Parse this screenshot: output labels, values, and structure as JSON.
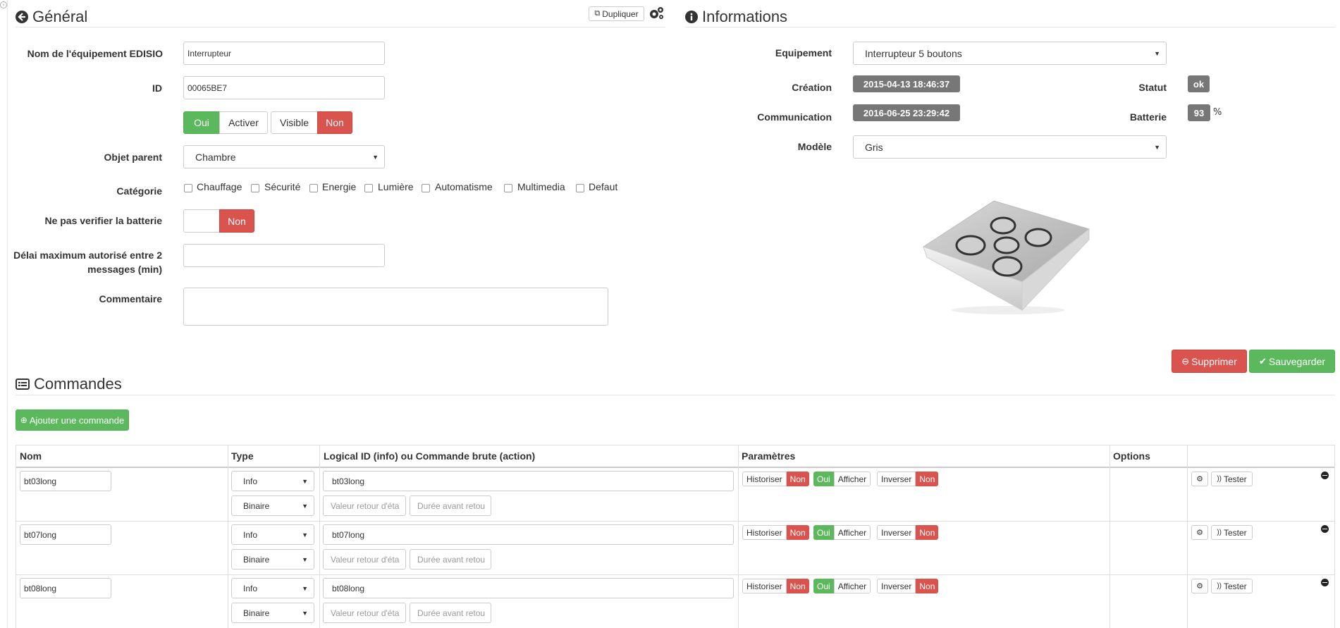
{
  "general": {
    "title": "Général",
    "duplicate_label": "Dupliquer",
    "fields": {
      "name_label": "Nom de l'équipement EDISIO",
      "name_value": "Interrupteur",
      "id_label": "ID",
      "id_value": "00065BE7",
      "activate_on": "Oui",
      "activate_label": "Activer",
      "visible_label": "Visible",
      "visible_off": "Non",
      "parent_label": "Objet parent",
      "parent_value": "Chambre",
      "category_label": "Catégorie",
      "categories": [
        "Chauffage",
        "Sécurité",
        "Energie",
        "Lumière",
        "Automatisme",
        "Multimedia",
        "Defaut"
      ],
      "battery_label": "Ne pas verifier la batterie",
      "battery_value": "Non",
      "delay_label_1": "Délai maximum autorisé entre 2",
      "delay_label_2": "messages (min)",
      "delay_value": "",
      "comment_label": "Commentaire",
      "comment_value": ""
    }
  },
  "info": {
    "title": "Informations",
    "equipment_label": "Equipement",
    "equipment_value": "Interrupteur 5 boutons",
    "creation_label": "Création",
    "creation_value": "2015-04-13 18:46:37",
    "status_label": "Statut",
    "status_value": "ok",
    "communication_label": "Communication",
    "communication_value": "2016-06-25 23:29:42",
    "battery_label": "Batterie",
    "battery_value": "93",
    "battery_unit": "%",
    "model_label": "Modèle",
    "model_value": "Gris"
  },
  "actions": {
    "delete_label": "Supprimer",
    "save_label": "Sauvegarder"
  },
  "commands": {
    "title": "Commandes",
    "add_label": "Ajouter une commande",
    "headers": [
      "Nom",
      "Type",
      "Logical ID (info) ou Commande brute (action)",
      "Paramètres",
      "Options",
      ""
    ],
    "return_value_placeholder": "Valeur retour d'éta",
    "return_delay_placeholder": "Durée avant retou",
    "historize_label": "Historiser",
    "display_label": "Afficher",
    "invert_label": "Inverser",
    "yes_label": "Oui",
    "no_label": "Non",
    "test_label": "Tester",
    "rows": [
      {
        "name": "bt03long",
        "type": "Info",
        "subtype": "Binaire",
        "logical_id": "bt03long"
      },
      {
        "name": "bt07long",
        "type": "Info",
        "subtype": "Binaire",
        "logical_id": "bt07long"
      },
      {
        "name": "bt08long",
        "type": "Info",
        "subtype": "Binaire",
        "logical_id": "bt08long"
      }
    ]
  }
}
